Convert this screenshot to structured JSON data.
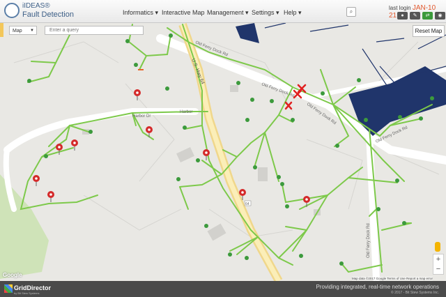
{
  "app": {
    "brand_line1": "iIDEAS®",
    "brand_line2": "Fault Detection"
  },
  "nav": [
    {
      "label": "Informatics ▾"
    },
    {
      "label": "Interactive Map"
    },
    {
      "label": "Management ▾"
    },
    {
      "label": "Settings ▾"
    },
    {
      "label": "Help ▾"
    }
  ],
  "header": {
    "last_login_label": "last login",
    "last_login_time": "JAN-10 21:51"
  },
  "map": {
    "type_select": "Map",
    "query_placeholder": "Enter a query",
    "reset_label": "Reset Map",
    "roads": {
      "old_ferry_dock_1": "Old Ferry Dock Rd",
      "old_ferry_dock_2": "Old Ferry Dock Rd",
      "old_ferry_dock_3": "Old Ferry Dock Rd",
      "old_ferry_dock_4": "Old Ferry Dock Rd",
      "old_ferry_dock_5": "Old Ferry Dock Rd",
      "hwy": "U.S. Hwy 64",
      "harbor_1": "Harbor Dr",
      "harbor_2": "Harbor",
      "hwy_shield": "64"
    },
    "google_label": "Google",
    "attribution": "Map data ©2017 Google    Terms of Use    Report a map error"
  },
  "footer": {
    "brand": "GridDirector",
    "brand_sub": "by Bit Stew Systems",
    "tagline": "Providing integrated, real-time network operations",
    "copyright": "© 2017 - Bit Stew Systems Inc."
  }
}
